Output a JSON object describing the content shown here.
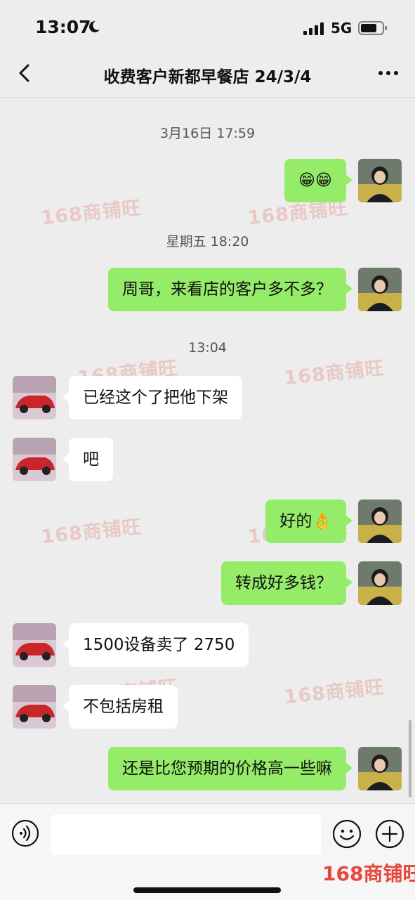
{
  "status_bar": {
    "time": "13:07",
    "network": "5G"
  },
  "header": {
    "title": "收费客户新都早餐店 24/3/4"
  },
  "watermark": {
    "text": "168商铺旺"
  },
  "timestamps": [
    "3月16日 17:59",
    "星期五 18:20",
    "13:04"
  ],
  "messages": [
    {
      "from": "me",
      "text": "😁😁"
    },
    {
      "from": "me",
      "text": "周哥，来看店的客户多不多？"
    },
    {
      "from": "other",
      "text": "已经这个了把他下架"
    },
    {
      "from": "other",
      "text": "吧"
    },
    {
      "from": "me",
      "text": "好的👌"
    },
    {
      "from": "me",
      "text": "转成好多钱？"
    },
    {
      "from": "other",
      "text": "1500设备卖了 2750"
    },
    {
      "from": "other",
      "text": "不包括房租"
    },
    {
      "from": "me",
      "text": "还是比您预期的价格高一些嘛"
    }
  ],
  "input": {
    "value": "",
    "placeholder": ""
  },
  "colors": {
    "me_bubble": "#95ec69",
    "other_bubble": "#ffffff",
    "background": "#ededed",
    "brand": "#e8483c"
  }
}
